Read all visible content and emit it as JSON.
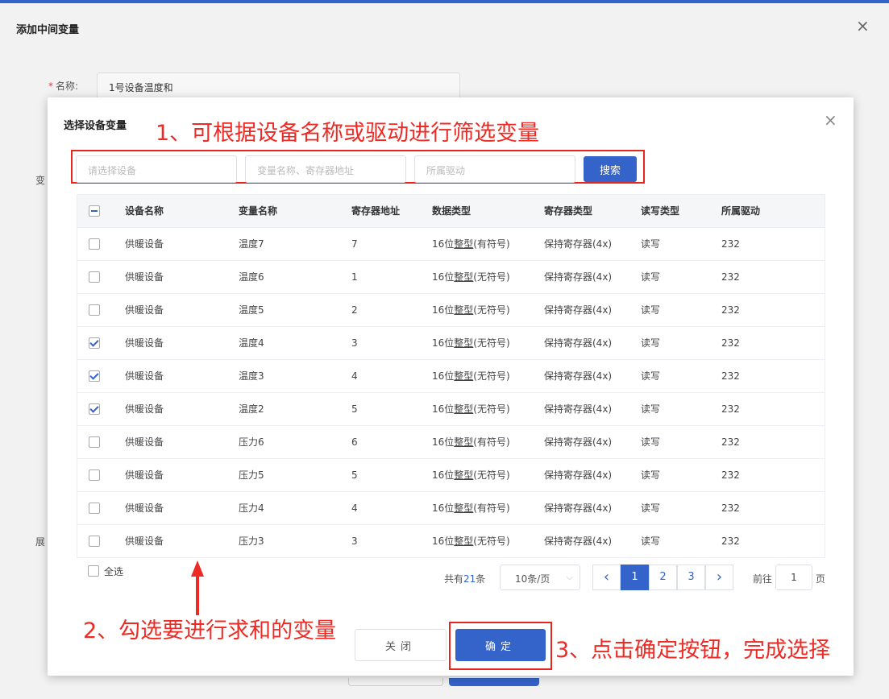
{
  "outer": {
    "title": "添加中间变量",
    "name_label": "名称:",
    "name_required": "*",
    "name_value": "1号设备温度和",
    "var_label_fragment": "变",
    "show_label_fragment": "展"
  },
  "modal": {
    "title": "选择设备变量",
    "close_icon": "×"
  },
  "filters": {
    "device_placeholder": "请选择设备",
    "var_placeholder": "变量名称、寄存器地址",
    "driver_placeholder": "所属驱动",
    "search_label": "搜索"
  },
  "table": {
    "headers": {
      "device": "设备名称",
      "var": "变量名称",
      "reg": "寄存器地址",
      "dtype": "数据类型",
      "rtype": "寄存器类型",
      "rw": "读写类型",
      "driver": "所属驱动"
    },
    "header_checkbox_state": "partial",
    "rows": [
      {
        "checked": false,
        "device": "供暖设备",
        "var": "温度7",
        "reg": "7",
        "dtype_a": "16位",
        "dtype_b": "整型",
        "dtype_c": "(有符号)",
        "rtype": "保持寄存器(4x)",
        "rw": "读写",
        "driver": "232"
      },
      {
        "checked": false,
        "device": "供暖设备",
        "var": "温度6",
        "reg": "1",
        "dtype_a": "16位",
        "dtype_b": "整型",
        "dtype_c": "(无符号)",
        "rtype": "保持寄存器(4x)",
        "rw": "读写",
        "driver": "232"
      },
      {
        "checked": false,
        "device": "供暖设备",
        "var": "温度5",
        "reg": "2",
        "dtype_a": "16位",
        "dtype_b": "整型",
        "dtype_c": "(无符号)",
        "rtype": "保持寄存器(4x)",
        "rw": "读写",
        "driver": "232"
      },
      {
        "checked": true,
        "device": "供暖设备",
        "var": "温度4",
        "reg": "3",
        "dtype_a": "16位",
        "dtype_b": "整型",
        "dtype_c": "(无符号)",
        "rtype": "保持寄存器(4x)",
        "rw": "读写",
        "driver": "232"
      },
      {
        "checked": true,
        "device": "供暖设备",
        "var": "温度3",
        "reg": "4",
        "dtype_a": "16位",
        "dtype_b": "整型",
        "dtype_c": "(无符号)",
        "rtype": "保持寄存器(4x)",
        "rw": "读写",
        "driver": "232"
      },
      {
        "checked": true,
        "device": "供暖设备",
        "var": "温度2",
        "reg": "5",
        "dtype_a": "16位",
        "dtype_b": "整型",
        "dtype_c": "(无符号)",
        "rtype": "保持寄存器(4x)",
        "rw": "读写",
        "driver": "232"
      },
      {
        "checked": false,
        "device": "供暖设备",
        "var": "压力6",
        "reg": "6",
        "dtype_a": "16位",
        "dtype_b": "整型",
        "dtype_c": "(有符号)",
        "rtype": "保持寄存器(4x)",
        "rw": "读写",
        "driver": "232"
      },
      {
        "checked": false,
        "device": "供暖设备",
        "var": "压力5",
        "reg": "5",
        "dtype_a": "16位",
        "dtype_b": "整型",
        "dtype_c": "(无符号)",
        "rtype": "保持寄存器(4x)",
        "rw": "读写",
        "driver": "232"
      },
      {
        "checked": false,
        "device": "供暖设备",
        "var": "压力4",
        "reg": "4",
        "dtype_a": "16位",
        "dtype_b": "整型",
        "dtype_c": "(有符号)",
        "rtype": "保持寄存器(4x)",
        "rw": "读写",
        "driver": "232"
      },
      {
        "checked": false,
        "device": "供暖设备",
        "var": "压力3",
        "reg": "3",
        "dtype_a": "16位",
        "dtype_b": "整型",
        "dtype_c": "(无符号)",
        "rtype": "保持寄存器(4x)",
        "rw": "读写",
        "driver": "232"
      }
    ]
  },
  "select_all": {
    "label": "全选",
    "checked": false
  },
  "pagination": {
    "total_prefix": "共有",
    "total_count": "21",
    "total_suffix": "条",
    "page_size": "10条/页",
    "page_size_arrow": "⌵",
    "prev_icon": "‹",
    "next_icon": "›",
    "pages": [
      "1",
      "2",
      "3"
    ],
    "current_page": "1",
    "goto_label": "前往",
    "goto_value": "1",
    "goto_suffix": "页"
  },
  "footer": {
    "close_label": "关闭",
    "confirm_label": "确定"
  },
  "annotations": {
    "step1": "1、可根据设备名称或驱动进行筛选变量",
    "step2": "2、勾选要进行求和的变量",
    "step3": "3、点击确定按钮，完成选择"
  },
  "colors": {
    "primary": "#3463c9",
    "annotation_red": "#ee2a24"
  }
}
